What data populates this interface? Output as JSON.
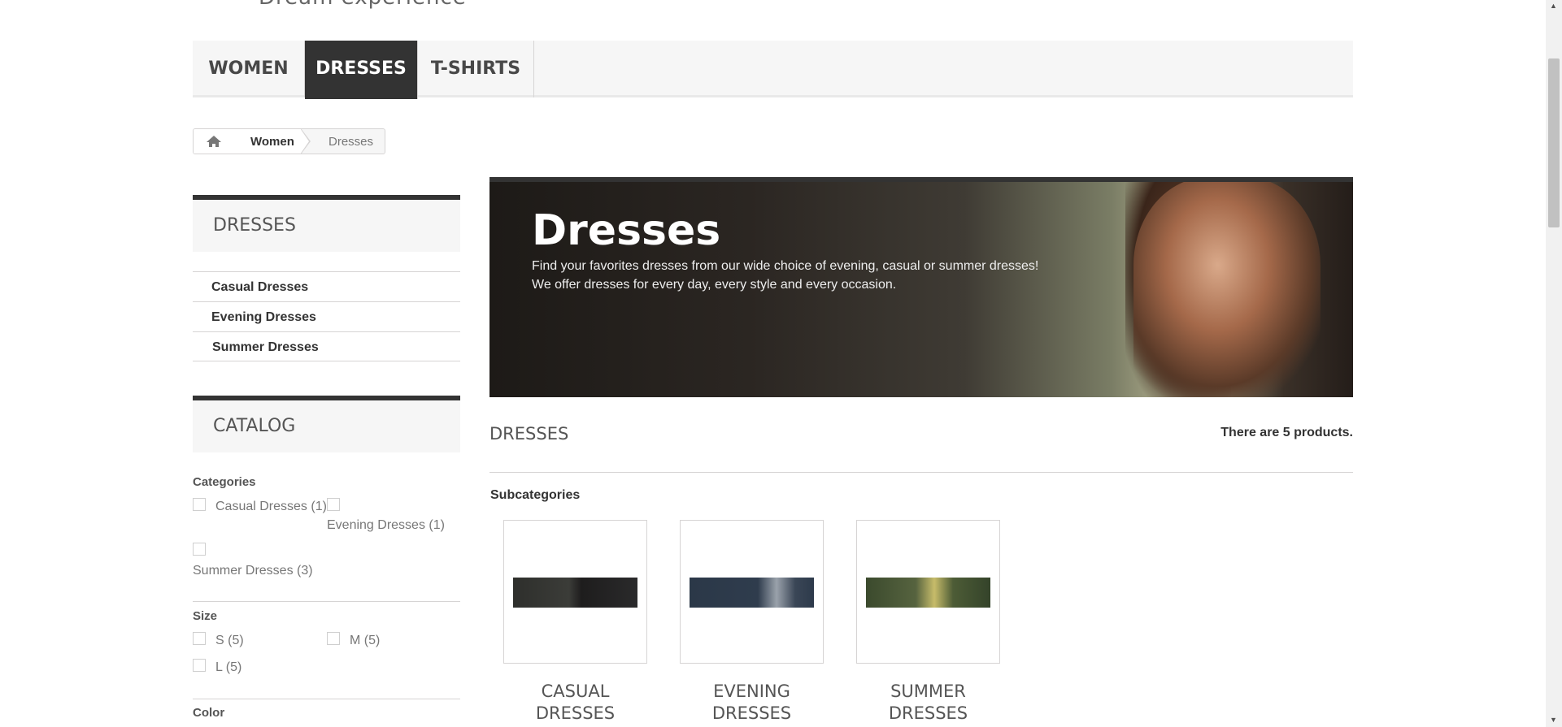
{
  "header": {
    "logo_fragment": "Dream experience"
  },
  "menu": [
    {
      "label": "WOMEN",
      "active": false
    },
    {
      "label": "DRESSES",
      "active": true
    },
    {
      "label": "T-SHIRTS",
      "active": false
    }
  ],
  "breadcrumb": {
    "home_icon": "home-icon",
    "items": [
      "Women",
      "Dresses"
    ]
  },
  "sidebar": {
    "dresses_title": "DRESSES",
    "subcategories": [
      "Casual Dresses",
      "Evening Dresses",
      "Summer Dresses"
    ],
    "catalog_title": "CATALOG",
    "categories_label": "Categories",
    "categories": [
      "Casual Dresses (1)",
      "Evening Dresses (1)",
      "Summer Dresses (3)"
    ],
    "size_label": "Size",
    "sizes": [
      "S (5)",
      "M (5)",
      "L (5)"
    ],
    "color_label": "Color"
  },
  "banner": {
    "title": "Dresses",
    "description_line1": "Find your favorites dresses from our wide choice of evening, casual or summer dresses!",
    "description_line2": "We offer dresses for every day, every style and every occasion."
  },
  "main": {
    "heading": "DRESSES",
    "product_count": "There are 5 products.",
    "subcategories_label": "Subcategories",
    "subcategories": [
      {
        "line1": "CASUAL",
        "line2": "DRESSES"
      },
      {
        "line1": "EVENING",
        "line2": "DRESSES"
      },
      {
        "line1": "SUMMER",
        "line2": "DRESSES"
      }
    ]
  },
  "colors": {
    "accent_dark": "#333333",
    "panel": "#f6f6f6",
    "border": "#d6d4d4"
  }
}
